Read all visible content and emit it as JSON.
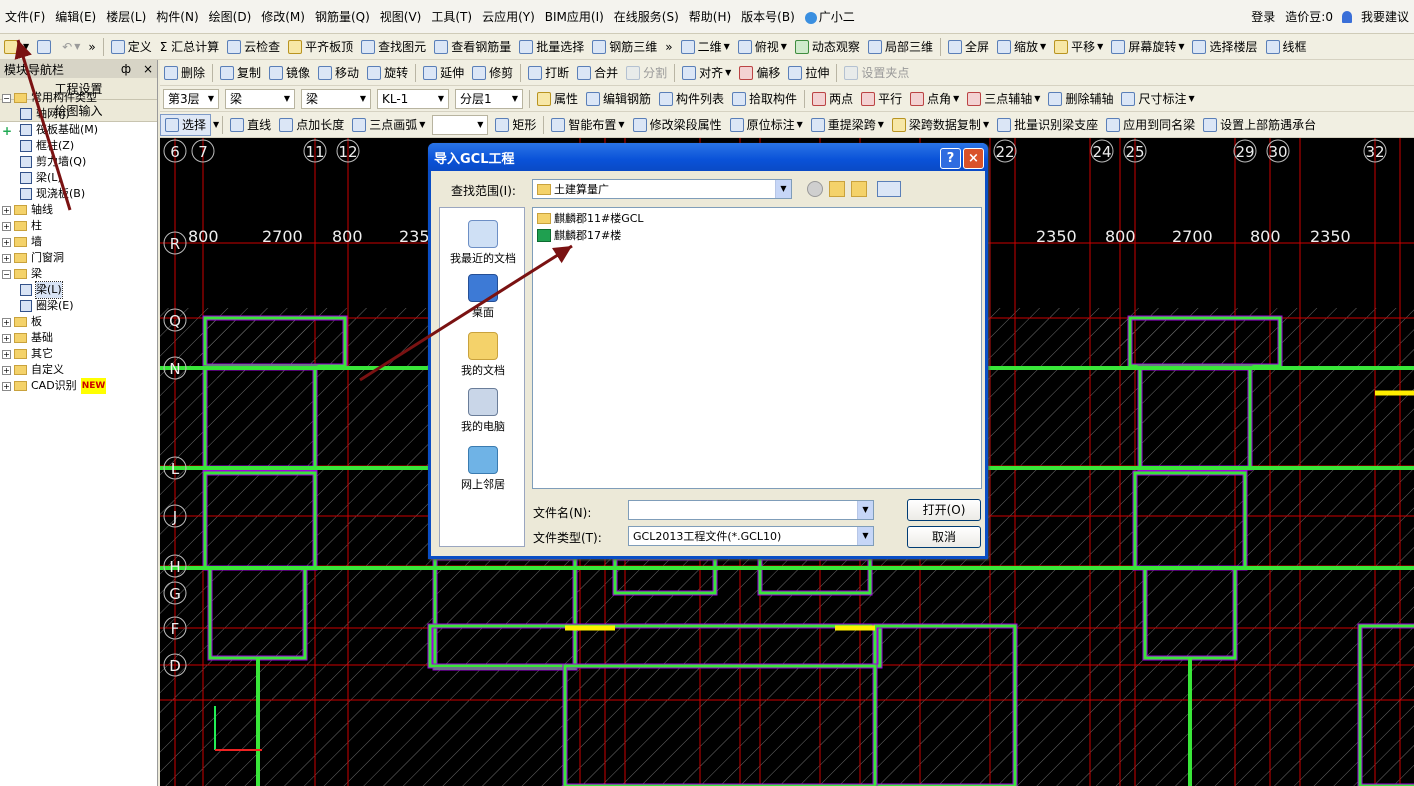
{
  "menu": {
    "items": [
      "文件(F)",
      "编辑(E)",
      "楼层(L)",
      "构件(N)",
      "绘图(D)",
      "修改(M)",
      "钢筋量(Q)",
      "视图(V)",
      "工具(T)",
      "云应用(Y)",
      "BIM应用(I)",
      "在线服务(S)",
      "帮助(H)",
      "版本号(B)",
      "广小二"
    ],
    "login": "登录",
    "price_bean": "造价豆:0",
    "suggest": "我要建议"
  },
  "toolbar1": {
    "items": [
      "定义",
      "Σ 汇总计算",
      "云检查",
      "平齐板顶",
      "查找图元",
      "查看钢筋量",
      "批量选择",
      "钢筋三维",
      "二维",
      "俯视",
      "动态观察",
      "局部三维",
      "全屏",
      "缩放",
      "平移",
      "屏幕旋转",
      "选择楼层",
      "线框"
    ]
  },
  "toolbar2": {
    "items": [
      "删除",
      "复制",
      "镜像",
      "移动",
      "旋转",
      "延伸",
      "修剪",
      "打断",
      "合并",
      "分割",
      "对齐",
      "偏移",
      "拉伸",
      "设置夹点"
    ]
  },
  "toolbar3": {
    "floor": "第3层",
    "type1": "梁",
    "type2": "梁",
    "component": "KL-1",
    "layer": "分层1",
    "items": [
      "属性",
      "编辑钢筋",
      "构件列表",
      "拾取构件",
      "两点",
      "平行",
      "点角",
      "三点辅轴",
      "删除辅轴",
      "尺寸标注"
    ]
  },
  "toolbar4": {
    "items": [
      "选择",
      "直线",
      "点加长度",
      "三点画弧",
      "矩形",
      "智能布置",
      "修改梁段属性",
      "原位标注",
      "重提梁跨",
      "梁跨数据复制",
      "批量识别梁支座",
      "应用到同名梁",
      "设置上部筋遇承台"
    ]
  },
  "leftpanel": {
    "title": "模块导航栏",
    "pin": "ф",
    "close": "×",
    "btn_project": "工程设置",
    "btn_draw": "绘图输入",
    "tree": [
      {
        "label": "常用构件类型",
        "level": 0,
        "expanded": true,
        "folder": true
      },
      {
        "label": "轴网(J)",
        "level": 1
      },
      {
        "label": "筏板基础(M)",
        "level": 1
      },
      {
        "label": "框柱(Z)",
        "level": 1
      },
      {
        "label": "剪力墙(Q)",
        "level": 1
      },
      {
        "label": "梁(L)",
        "level": 1
      },
      {
        "label": "现浇板(B)",
        "level": 1
      },
      {
        "label": "轴线",
        "level": 0,
        "expanded": false,
        "folder": true
      },
      {
        "label": "柱",
        "level": 0,
        "expanded": false,
        "folder": true
      },
      {
        "label": "墙",
        "level": 0,
        "expanded": false,
        "folder": true
      },
      {
        "label": "门窗洞",
        "level": 0,
        "expanded": false,
        "folder": true
      },
      {
        "label": "梁",
        "level": 0,
        "expanded": true,
        "folder": true
      },
      {
        "label": "梁(L)",
        "level": 1,
        "selected": true
      },
      {
        "label": "圈梁(E)",
        "level": 1
      },
      {
        "label": "板",
        "level": 0,
        "expanded": false,
        "folder": true
      },
      {
        "label": "基础",
        "level": 0,
        "expanded": false,
        "folder": true
      },
      {
        "label": "其它",
        "level": 0,
        "expanded": false,
        "folder": true
      },
      {
        "label": "自定义",
        "level": 0,
        "expanded": false,
        "folder": true
      },
      {
        "label": "CAD识别",
        "level": 0,
        "expanded": false,
        "folder": true,
        "badge": "NEW"
      }
    ]
  },
  "canvas": {
    "axis_numbers_top": [
      "6",
      "7",
      "11",
      "12",
      "22",
      "24",
      "25",
      "29",
      "30",
      "32"
    ],
    "dims_left": [
      "800",
      "2700",
      "800",
      "2350"
    ],
    "dims_right": [
      "2350",
      "800",
      "2700",
      "800",
      "2350"
    ],
    "axis_letters": [
      "R",
      "Q",
      "N",
      "L",
      "J",
      "H",
      "G",
      "F",
      "D"
    ],
    "colors": {
      "beam": "#39e639",
      "outline": "#a000e0",
      "grid": "#cc0000",
      "bg": "#000000",
      "highlight": "#ffee00"
    }
  },
  "dialog": {
    "title": "导入GCL工程",
    "help": "?",
    "close": "×",
    "look_in_label": "查找范围(I):",
    "look_in_value": "土建算量广",
    "places": [
      "我最近的文档",
      "桌面",
      "我的文档",
      "我的电脑",
      "网上邻居"
    ],
    "files": [
      {
        "name": "麒麟郡11#楼GCL",
        "type": "folder"
      },
      {
        "name": "麒麟郡17#楼",
        "type": "file"
      }
    ],
    "filename_label": "文件名(N):",
    "filename_value": "",
    "filetype_label": "文件类型(T):",
    "filetype_value": "GCL2013工程文件(*.GCL10)",
    "open_btn": "打开(O)",
    "cancel_btn": "取消"
  }
}
